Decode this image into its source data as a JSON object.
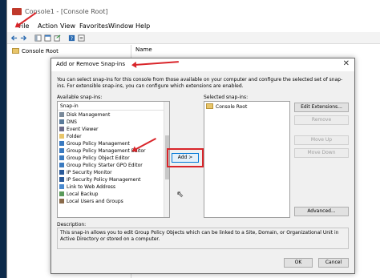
{
  "window": {
    "title": "Console1 - [Console Root]"
  },
  "menu": [
    "File",
    "Action",
    "View",
    "Favorites",
    "Window",
    "Help"
  ],
  "tree": {
    "root": "Console Root"
  },
  "content": {
    "name_header": "Name"
  },
  "dialog": {
    "title": "Add or Remove Snap-ins",
    "close": "✕",
    "description": "You can select snap-ins for this console from those available on your computer and configure the selected set of snap-ins. For extensible snap-ins, you can configure which extensions are enabled.",
    "available_label": "Available snap-ins:",
    "available_header": "Snap-in",
    "available_items": [
      "Disk Management",
      "DNS",
      "Event Viewer",
      "Folder",
      "Group Policy Management",
      "Group Policy Management Editor",
      "Group Policy Object Editor",
      "Group Policy Starter GPO Editor",
      "IP Security Monitor",
      "IP Security Policy Management",
      "Link to Web Address",
      "Local Backup",
      "Local Users and Groups"
    ],
    "add_button": "Add >",
    "selected_label": "Selected snap-ins:",
    "selected_items": [
      "Console Root"
    ],
    "buttons": {
      "edit_extensions": "Edit Extensions...",
      "remove": "Remove",
      "move_up": "Move Up",
      "move_down": "Move Down",
      "advanced": "Advanced...",
      "ok": "OK",
      "cancel": "Cancel"
    },
    "description_label": "Description:",
    "description_text": "This snap-in allows you to edit Group Policy Objects which can be linked to a Site, Domain, or Organizational Unit in Active Directory or stored on a computer."
  },
  "colors": {
    "annotation_red": "#d9252a",
    "focus_blue": "#0078d7"
  }
}
